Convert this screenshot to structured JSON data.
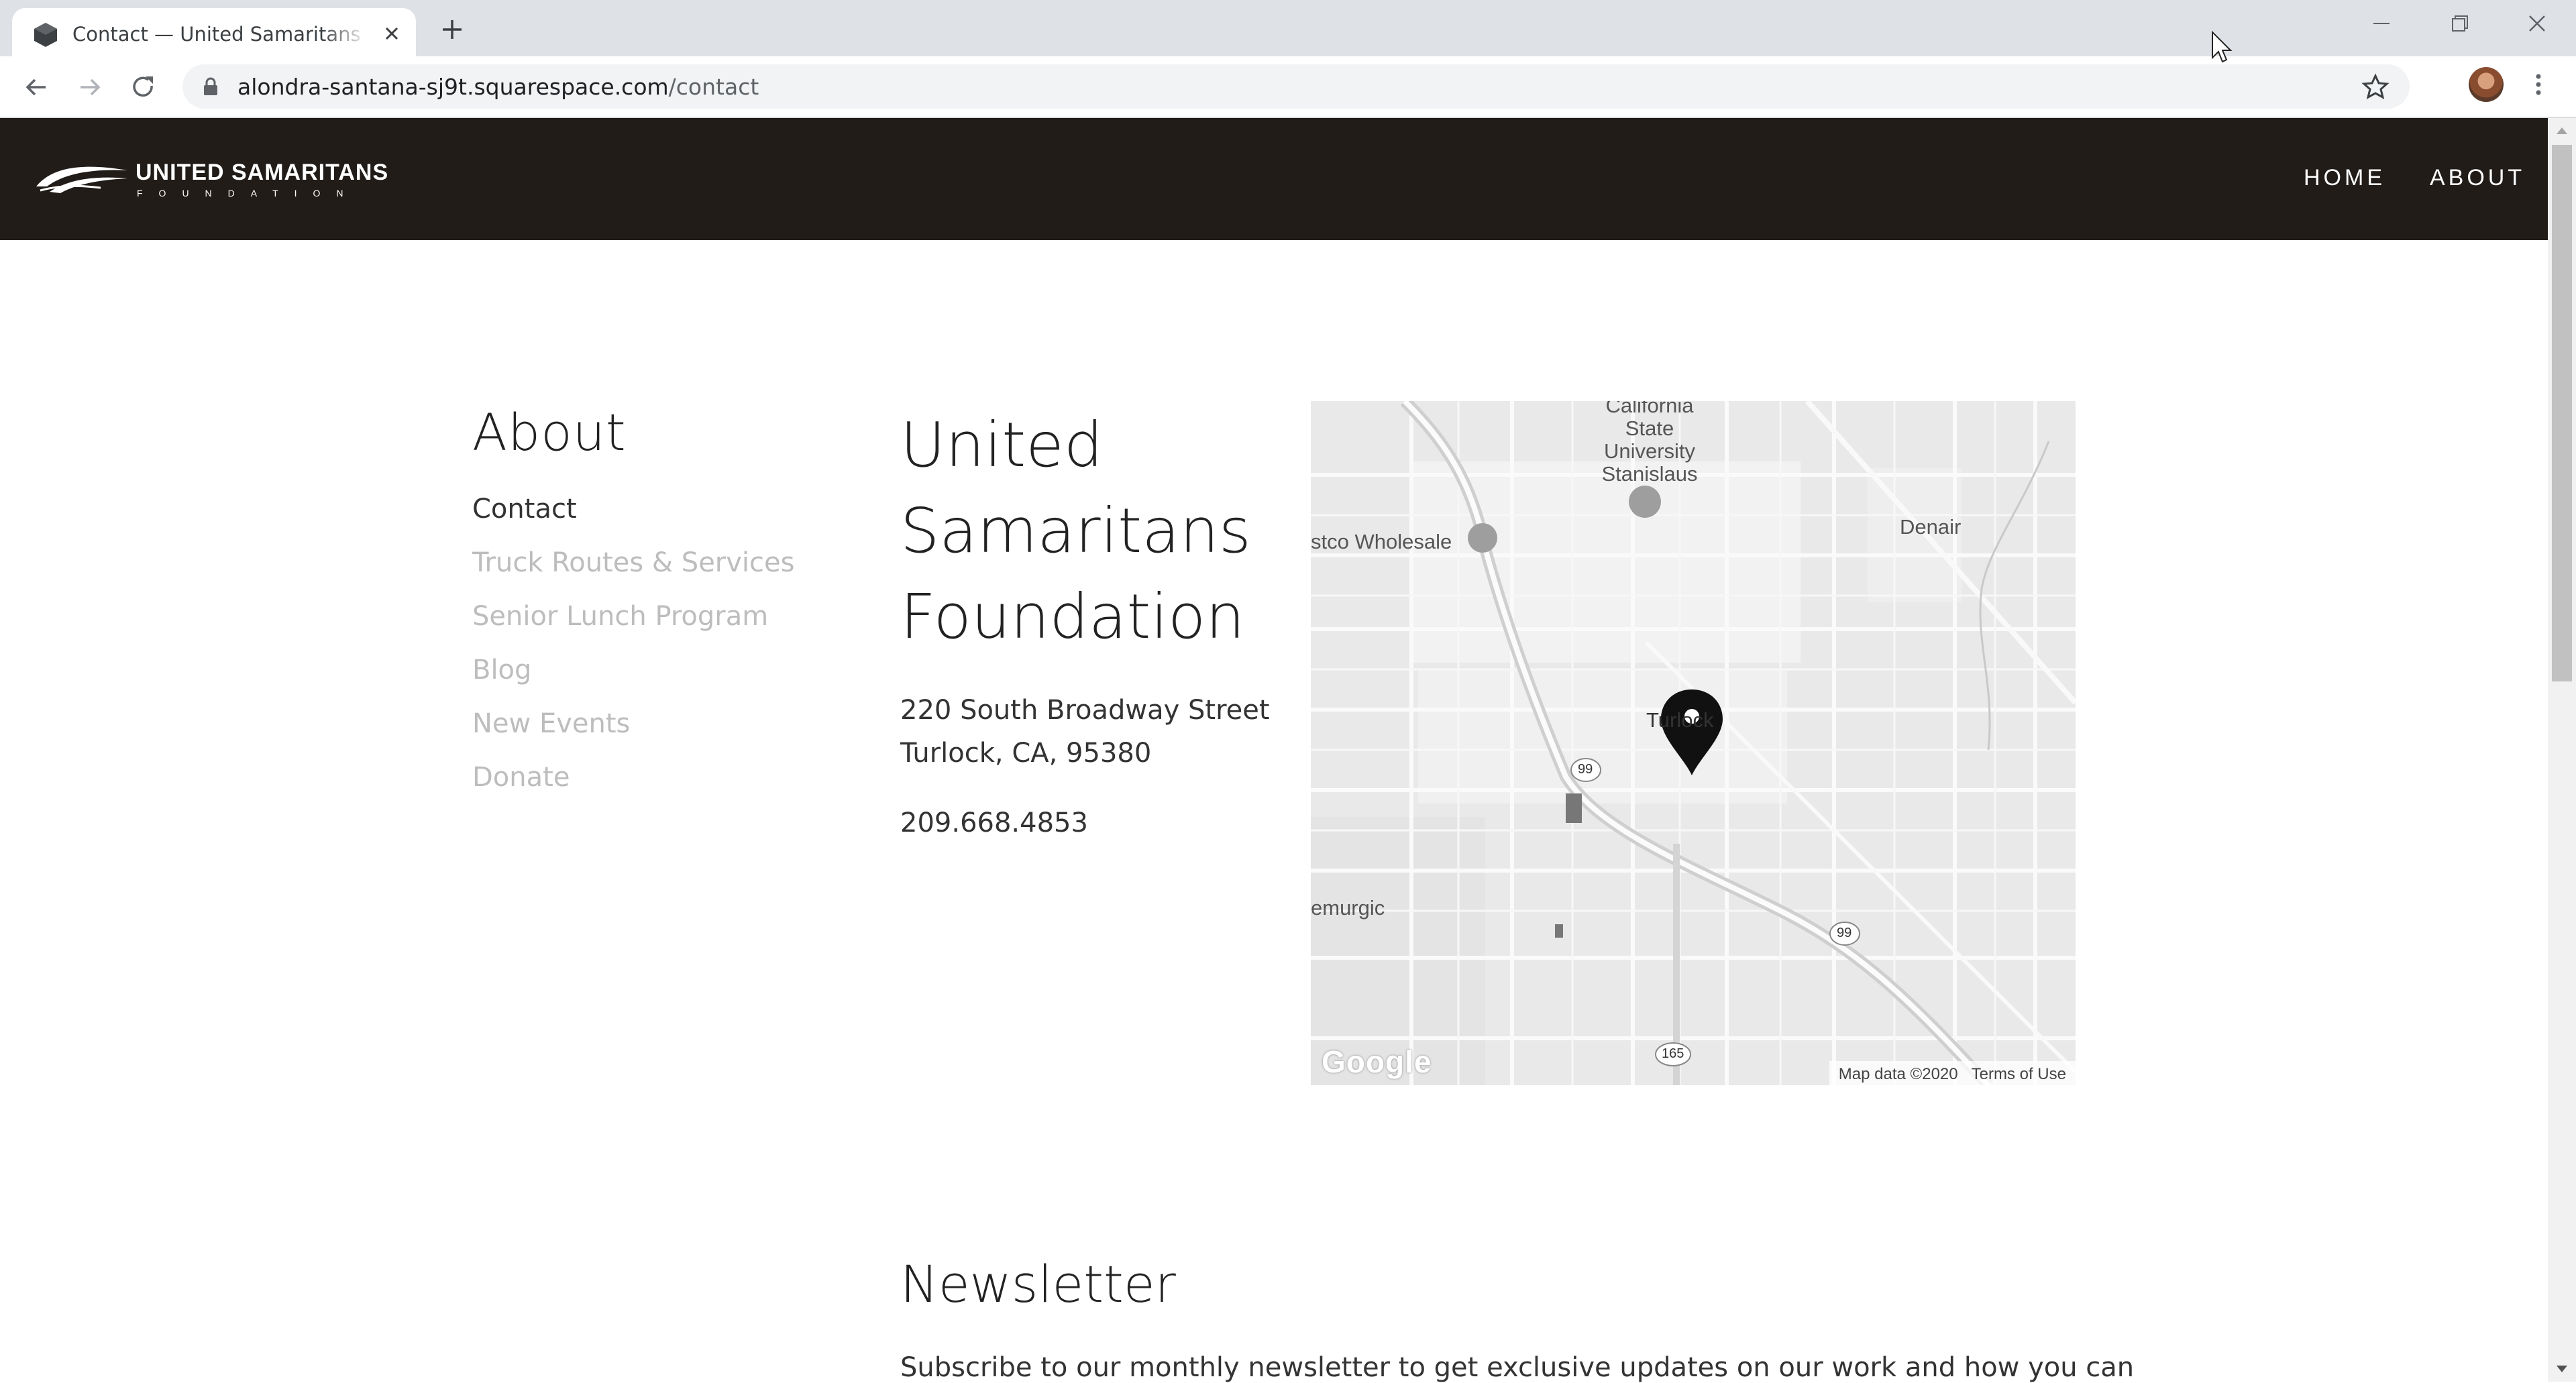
{
  "browser": {
    "tab_title": "Contact — United Samaritans Foundation",
    "url_host": "alondra-santana-sj9t.squarespace.com",
    "url_path": "/contact"
  },
  "site": {
    "logo_name": "UNITED SAMARITANS",
    "logo_sub": "FOUNDATION",
    "nav": [
      "HOME",
      "ABOUT"
    ]
  },
  "sidebar": {
    "heading": "About",
    "links": [
      "Contact",
      "Truck Routes & Services",
      "Senior Lunch Program",
      "Blog",
      "New Events",
      "Donate"
    ],
    "active": "Contact"
  },
  "contact": {
    "org_name": "United Samaritans Foundation",
    "address_line1": "220 South Broadway Street",
    "address_line2": "Turlock, CA, 95380",
    "phone": "209.668.4853"
  },
  "map": {
    "labels": {
      "csu": "California State University Stanislaus",
      "costco": "stco Wholesale",
      "denair": "Denair",
      "turlock": "Turlock",
      "hemurgic": "emurgic"
    },
    "route_99a": "99",
    "route_99b": "99",
    "route_165": "165",
    "google": "Google",
    "map_data": "Map data ©2020",
    "terms": "Terms of Use"
  },
  "newsletter": {
    "heading": "Newsletter",
    "text": "Subscribe to our monthly newsletter to get exclusive updates on our work and how you can"
  },
  "colors": {
    "header_bg": "#211c18",
    "chrome_bg": "#dee1e6",
    "inactive_link": "#bdbdbd"
  }
}
